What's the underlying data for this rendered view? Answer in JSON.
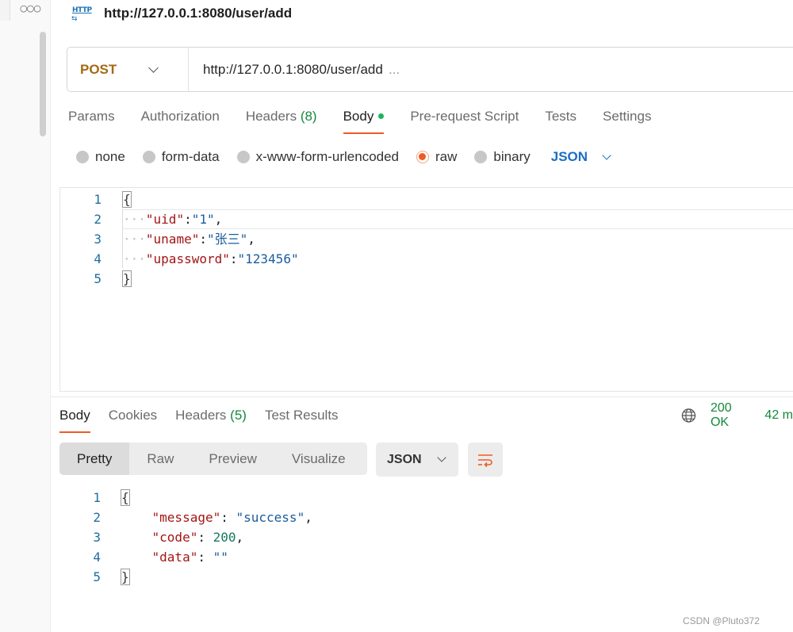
{
  "title": {
    "icon": "http-icon",
    "icon_text": "HTTP",
    "text": "http://127.0.0.1:8080/user/add"
  },
  "request": {
    "method": "POST",
    "url": "http://127.0.0.1:8080/user/add",
    "url_overflow": "..."
  },
  "request_tabs": [
    {
      "label": "Params"
    },
    {
      "label": "Authorization"
    },
    {
      "label": "Headers",
      "count": "(8)"
    },
    {
      "label": "Body",
      "active": true,
      "indicator": "green-dot"
    },
    {
      "label": "Pre-request Script"
    },
    {
      "label": "Tests"
    },
    {
      "label": "Settings"
    }
  ],
  "body_types": [
    {
      "label": "none",
      "checked": false
    },
    {
      "label": "form-data",
      "checked": false
    },
    {
      "label": "x-www-form-urlencoded",
      "checked": false
    },
    {
      "label": "raw",
      "checked": true
    },
    {
      "label": "binary",
      "checked": false
    }
  ],
  "body_language": "JSON",
  "request_body": {
    "line_numbers": [
      "1",
      "2",
      "3",
      "4",
      "5"
    ],
    "open_brace": "{",
    "close_brace": "}",
    "fields": [
      {
        "key": "\"uid\"",
        "value": "\"1\"",
        "sep": ":",
        "trail": ","
      },
      {
        "key": "\"uname\"",
        "value": "\"张三\"",
        "sep": ":",
        "trail": ","
      },
      {
        "key": "\"upassword\"",
        "value": "\"123456\"",
        "sep": ":",
        "trail": ""
      }
    ]
  },
  "response_tabs": [
    {
      "label": "Body",
      "active": true
    },
    {
      "label": "Cookies"
    },
    {
      "label": "Headers",
      "count": "(5)"
    },
    {
      "label": "Test Results"
    }
  ],
  "response_meta": {
    "status": "200 OK",
    "time": "42 m"
  },
  "view_options": [
    "Pretty",
    "Raw",
    "Preview",
    "Visualize"
  ],
  "response_language": "JSON",
  "response_body": {
    "line_numbers": [
      "1",
      "2",
      "3",
      "4",
      "5"
    ],
    "open_brace": "{",
    "close_brace": "}",
    "fields": [
      {
        "key": "\"message\"",
        "value": "\"success\"",
        "value_type": "string",
        "trail": ","
      },
      {
        "key": "\"code\"",
        "value": "200",
        "value_type": "number",
        "trail": ","
      },
      {
        "key": "\"data\"",
        "value": "\"\"",
        "value_type": "string",
        "trail": ""
      }
    ]
  },
  "watermark": "CSDN @Pluto372",
  "colors": {
    "accent": "#ef5b25",
    "method": "#a46a14",
    "status_ok": "#128a3a",
    "language_link": "#1a6fc2"
  }
}
